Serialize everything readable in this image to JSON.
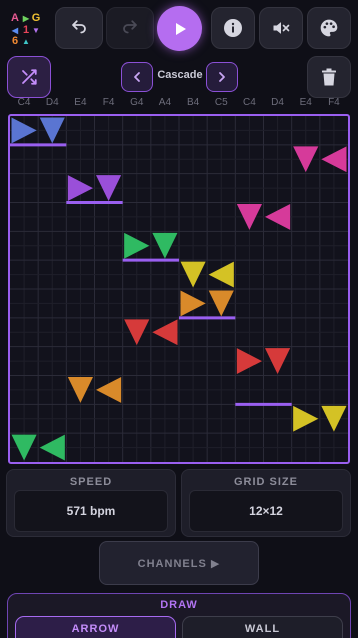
{
  "logo": {
    "letters": [
      {
        "ch": "A",
        "color": "#e85a93"
      },
      {
        "ch": "▶",
        "color": "#6ed15e"
      },
      {
        "ch": "G",
        "color": "#f0c233"
      },
      {
        "ch": "◀",
        "color": "#5b8cf0"
      },
      {
        "ch": "1",
        "color": "#e8455a"
      },
      {
        "ch": "▼",
        "color": "#b474f0"
      },
      {
        "ch": "6",
        "color": "#f08a33"
      },
      {
        "ch": "▲",
        "color": "#3ec6c6"
      }
    ]
  },
  "toolbar": {
    "undo_icon": "undo-icon",
    "redo_icon": "redo-icon",
    "play_icon": "play-icon",
    "info_icon": "info-icon",
    "mute_icon": "mute-icon",
    "palette_icon": "palette-icon"
  },
  "controls": {
    "preset_name": "Cascade",
    "prev_icon": "chevron-left-icon",
    "next_icon": "chevron-right-icon",
    "shuffle_icon": "shuffle-icon",
    "trash_icon": "trash-icon"
  },
  "notes": [
    "C4",
    "D4",
    "E4",
    "F4",
    "G4",
    "A4",
    "B4",
    "C5",
    "C4",
    "D4",
    "E4",
    "F4"
  ],
  "grid": {
    "cols": 12,
    "rows": 12,
    "arrows": [
      {
        "col": 0,
        "row": 0,
        "dir": "right",
        "color": "#5a75d2"
      },
      {
        "col": 1,
        "row": 0,
        "dir": "down",
        "color": "#5a75d2"
      },
      {
        "col": 10,
        "row": 1,
        "dir": "down",
        "color": "#d63a9a"
      },
      {
        "col": 11,
        "row": 1,
        "dir": "left",
        "color": "#d63a9a"
      },
      {
        "col": 2,
        "row": 2,
        "dir": "right",
        "color": "#9a4fd9"
      },
      {
        "col": 3,
        "row": 2,
        "dir": "down",
        "color": "#9a4fd9"
      },
      {
        "col": 8,
        "row": 3,
        "dir": "down",
        "color": "#d63a9a"
      },
      {
        "col": 9,
        "row": 3,
        "dir": "left",
        "color": "#d63a9a"
      },
      {
        "col": 4,
        "row": 4,
        "dir": "right",
        "color": "#2fba62"
      },
      {
        "col": 5,
        "row": 4,
        "dir": "down",
        "color": "#2fba62"
      },
      {
        "col": 6,
        "row": 5,
        "dir": "down",
        "color": "#d4c225"
      },
      {
        "col": 7,
        "row": 5,
        "dir": "left",
        "color": "#d4c225"
      },
      {
        "col": 6,
        "row": 6,
        "dir": "right",
        "color": "#d98a2a"
      },
      {
        "col": 7,
        "row": 6,
        "dir": "down",
        "color": "#d98a2a"
      },
      {
        "col": 4,
        "row": 7,
        "dir": "down",
        "color": "#d63a3a"
      },
      {
        "col": 5,
        "row": 7,
        "dir": "left",
        "color": "#d63a3a"
      },
      {
        "col": 8,
        "row": 8,
        "dir": "right",
        "color": "#d63a3a"
      },
      {
        "col": 9,
        "row": 8,
        "dir": "down",
        "color": "#d63a3a"
      },
      {
        "col": 2,
        "row": 9,
        "dir": "down",
        "color": "#d98a2a"
      },
      {
        "col": 3,
        "row": 9,
        "dir": "left",
        "color": "#d98a2a"
      },
      {
        "col": 10,
        "row": 10,
        "dir": "right",
        "color": "#d4c225"
      },
      {
        "col": 11,
        "row": 10,
        "dir": "down",
        "color": "#d4c225"
      },
      {
        "col": 0,
        "row": 11,
        "dir": "down",
        "color": "#2fba62"
      },
      {
        "col": 1,
        "row": 11,
        "dir": "left",
        "color": "#2fba62"
      }
    ],
    "walls": [
      {
        "col": 0,
        "row": 1,
        "span": 2
      },
      {
        "col": 2,
        "row": 3,
        "span": 2
      },
      {
        "col": 4,
        "row": 5,
        "span": 2
      },
      {
        "col": 6,
        "row": 7,
        "span": 2
      },
      {
        "col": 8,
        "row": 10,
        "span": 2
      }
    ]
  },
  "settings": {
    "speed_label": "SPEED",
    "speed_value": "571 bpm",
    "grid_label": "GRID SIZE",
    "grid_value": "12×12"
  },
  "channels": {
    "label": "CHANNELS ▶"
  },
  "draw": {
    "title": "DRAW",
    "arrow_label": "ARROW",
    "wall_label": "WALL"
  },
  "colors": {
    "accent": "#b56df0",
    "border": "#9a5ff0"
  }
}
